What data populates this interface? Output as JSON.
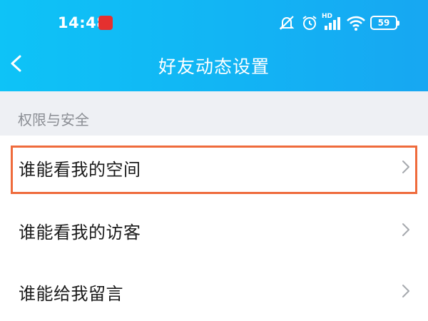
{
  "status_bar": {
    "time": "14:48",
    "app_badge": "",
    "battery": "59",
    "icons": [
      "alarm-muted-icon",
      "alarm-clock-icon",
      "hd-signal-icon",
      "wifi-icon",
      "battery-icon"
    ],
    "network_label": "HD"
  },
  "nav": {
    "back_icon": "chevron-left-icon",
    "title": "好友动态设置"
  },
  "section": {
    "label": "权限与安全"
  },
  "items": [
    {
      "label": "谁能看我的空间",
      "highlighted": true
    },
    {
      "label": "谁能看我的访客",
      "highlighted": false
    },
    {
      "label": "谁能给我留言",
      "highlighted": false
    }
  ],
  "colors": {
    "header": "#12b4f4",
    "highlight": "#ef6b3c",
    "section_bg": "#eef0f4"
  }
}
